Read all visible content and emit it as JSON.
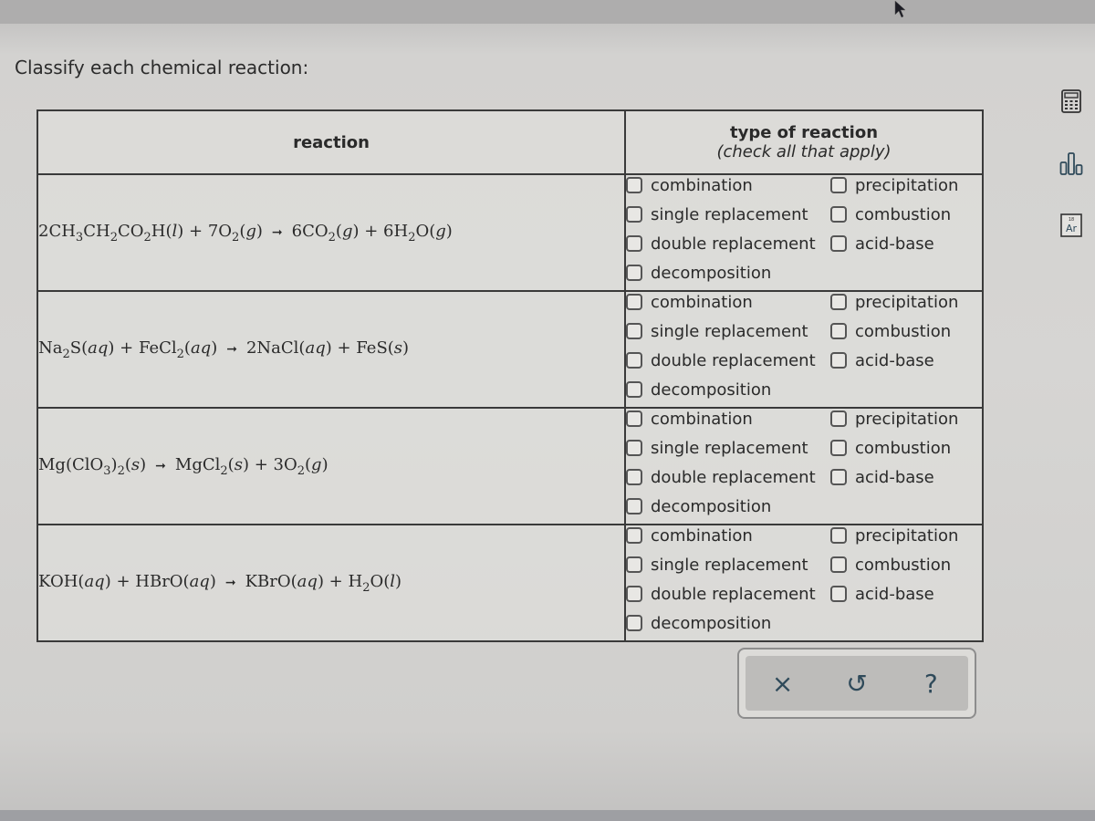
{
  "prompt": "Classify each chemical reaction:",
  "table": {
    "header_reaction": "reaction",
    "header_type": "type of reaction",
    "header_type_note": "(check all that apply)"
  },
  "option_labels": {
    "combination": "combination",
    "single_replacement": "single replacement",
    "double_replacement": "double replacement",
    "decomposition": "decomposition",
    "precipitation": "precipitation",
    "combustion": "combustion",
    "acid_base": "acid-base"
  },
  "reactions": [
    {
      "equation": "2CH3CH2CO2H(l) + 7O2(g) → 6CO2(g) + 6H2O(g)",
      "checked": {
        "combination": false,
        "single_replacement": false,
        "double_replacement": false,
        "decomposition": false,
        "precipitation": false,
        "combustion": false,
        "acid_base": false
      }
    },
    {
      "equation": "Na2S(aq) + FeCl2(aq) → 2NaCl(aq) + FeS(s)",
      "checked": {
        "combination": false,
        "single_replacement": false,
        "double_replacement": false,
        "decomposition": false,
        "precipitation": false,
        "combustion": false,
        "acid_base": false
      }
    },
    {
      "equation": "Mg(ClO3)2(s) → MgCl2(s) + 3O2(g)",
      "checked": {
        "combination": false,
        "single_replacement": false,
        "double_replacement": false,
        "decomposition": false,
        "precipitation": false,
        "combustion": false,
        "acid_base": false
      }
    },
    {
      "equation": "KOH(aq) + HBrO(aq) → KBrO(aq) + H2O(l)",
      "checked": {
        "combination": false,
        "single_replacement": false,
        "double_replacement": false,
        "decomposition": false,
        "precipitation": false,
        "combustion": false,
        "acid_base": false
      }
    }
  ],
  "sidebar": {
    "tools": [
      {
        "icon": "calculator-icon"
      },
      {
        "icon": "bar-chart-icon"
      },
      {
        "icon": "periodic-table-icon",
        "label": "Ar",
        "number": "18"
      }
    ]
  },
  "actions": {
    "clear": "×",
    "undo": "↺",
    "help": "?"
  },
  "colors": {
    "icon_accent": "#2f4a5a",
    "border": "#3a3a3a"
  }
}
